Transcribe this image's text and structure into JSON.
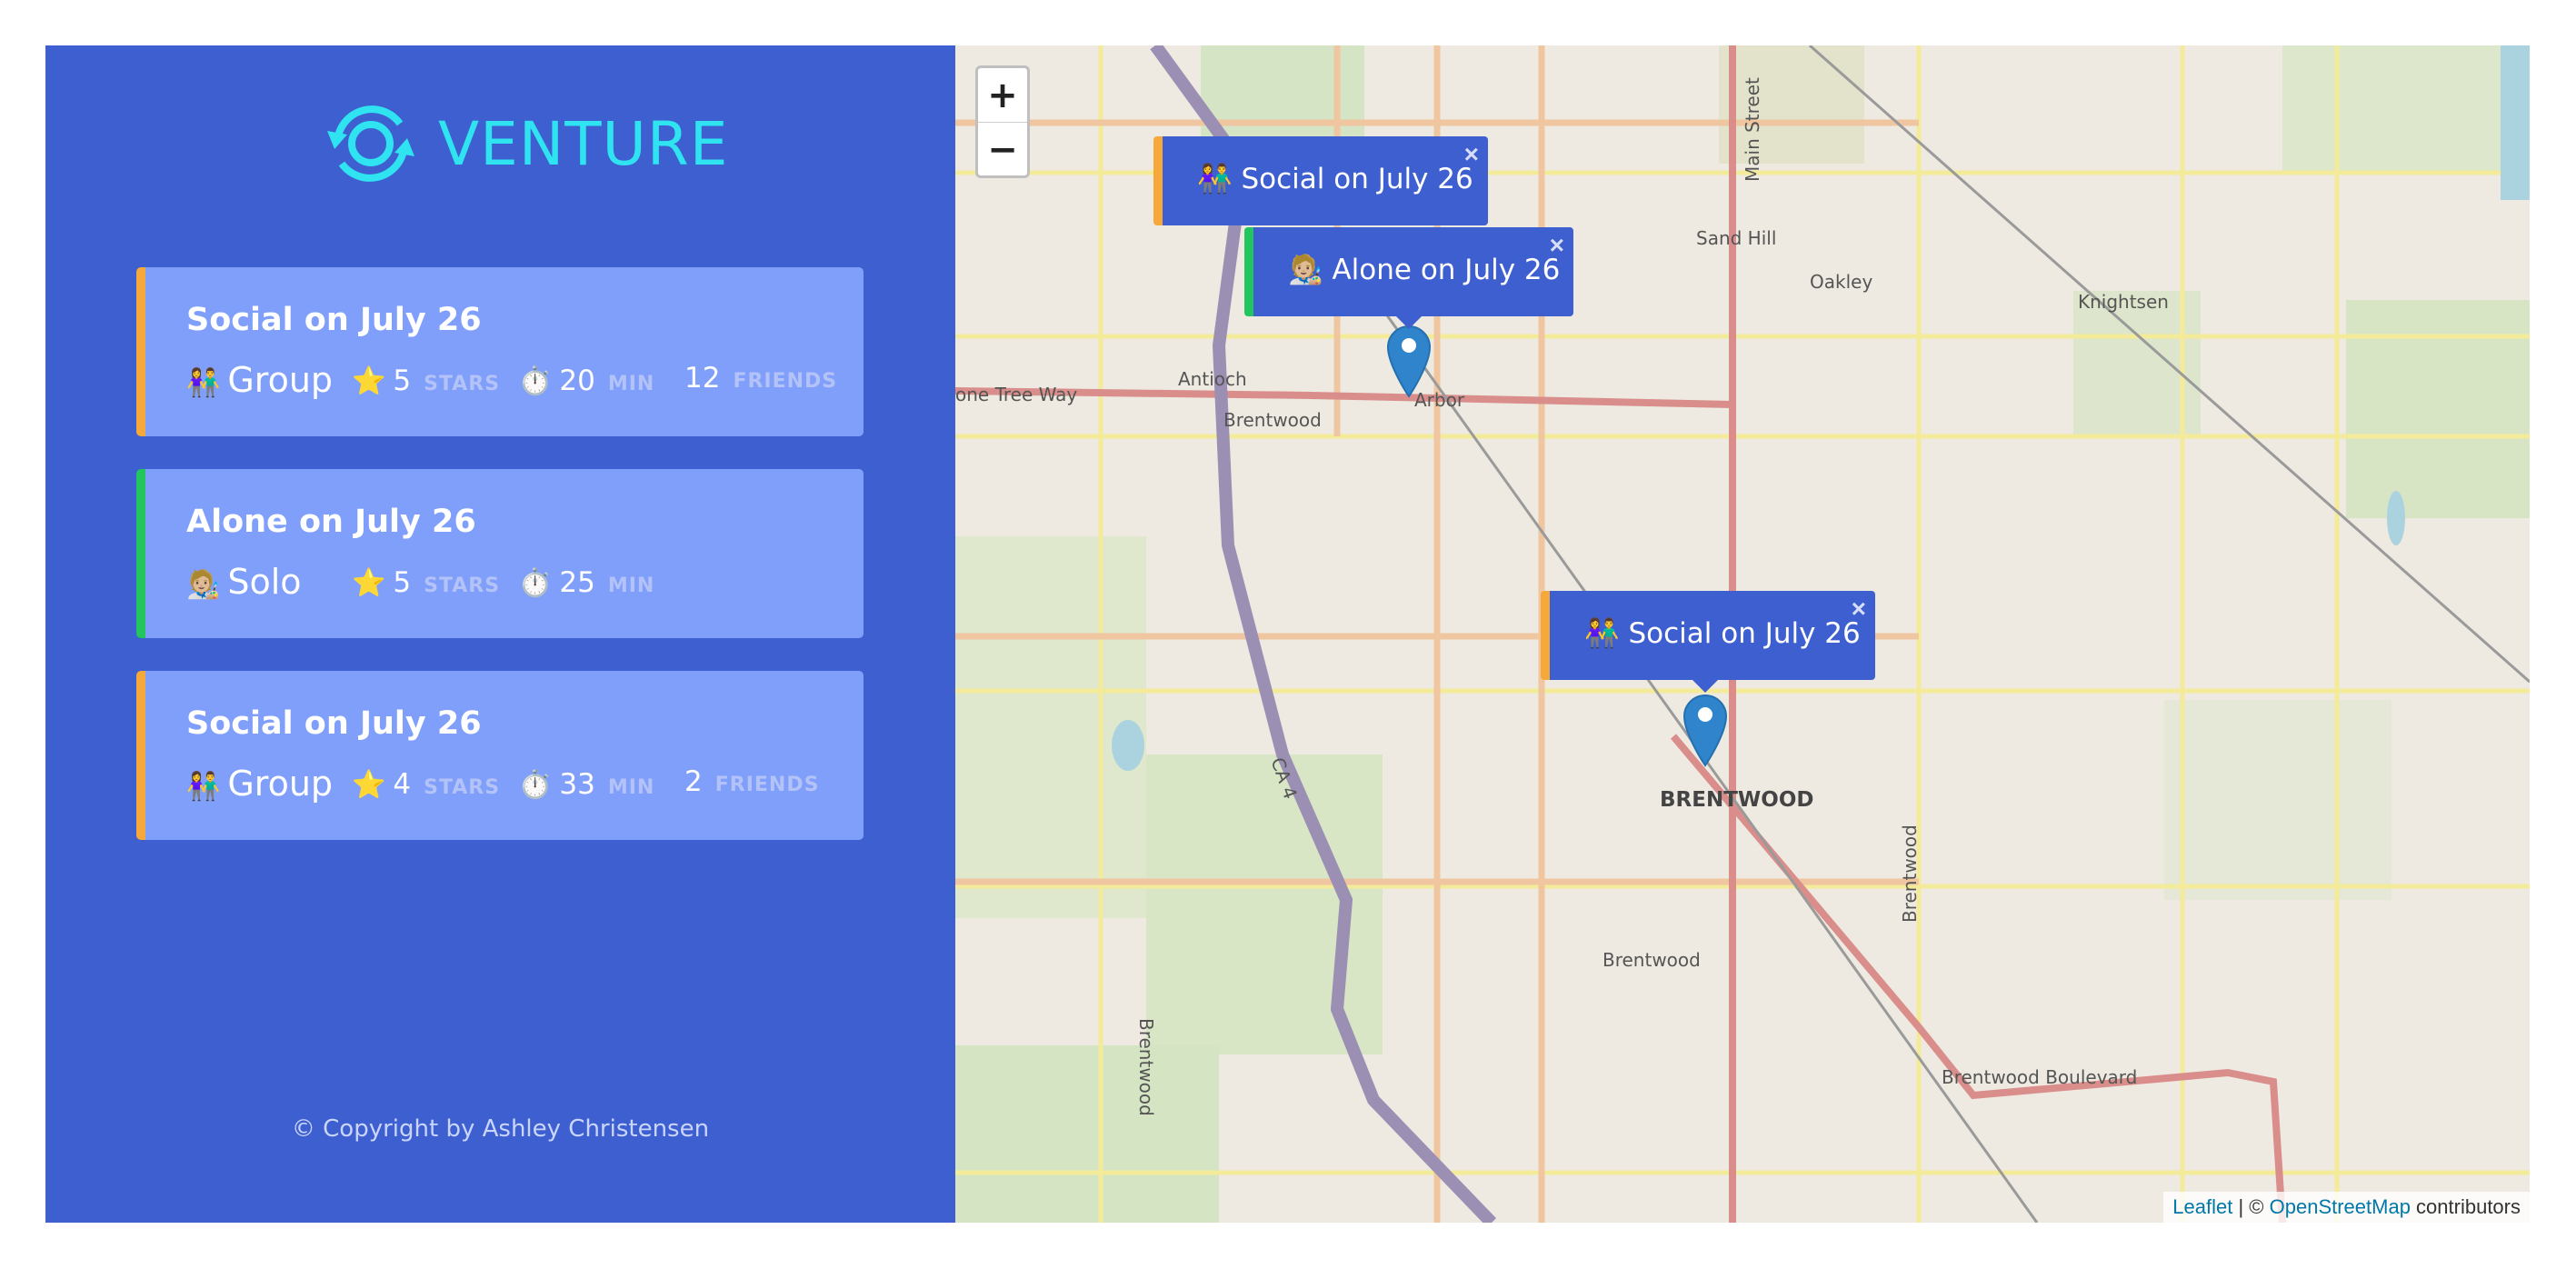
{
  "brand": {
    "name": "VENTURE",
    "logo_icon": "refresh-cycle-icon",
    "accent": "#2fe3f0"
  },
  "colors": {
    "sidebar": "#3e5fd0",
    "card": "#809ffb",
    "group_accent": "#f6a93b",
    "solo_accent": "#22c55e"
  },
  "ventures": [
    {
      "title": "Social on July 26",
      "type_emoji": "👫",
      "type_label": "Group",
      "star_emoji": "⭐",
      "stars": "5",
      "stars_unit": "STARS",
      "timer_emoji": "⏱️",
      "minutes": "20",
      "minutes_unit": "MIN",
      "friends": "12",
      "friends_unit": "FRIENDS"
    },
    {
      "title": "Alone on July 26",
      "type_emoji": "🧑🏼‍🎨",
      "type_label": "Solo",
      "star_emoji": "⭐",
      "stars": "5",
      "stars_unit": "STARS",
      "timer_emoji": "⏱️",
      "minutes": "25",
      "minutes_unit": "MIN"
    },
    {
      "title": "Social on July 26",
      "type_emoji": "👫",
      "type_label": "Group",
      "star_emoji": "⭐",
      "stars": "4",
      "stars_unit": "STARS",
      "timer_emoji": "⏱️",
      "minutes": "33",
      "minutes_unit": "MIN",
      "friends": "2",
      "friends_unit": "FRIENDS"
    }
  ],
  "footer": {
    "copyright": "© Copyright by Ashley Christensen"
  },
  "map": {
    "zoom_in": "+",
    "zoom_out": "−",
    "popups": [
      {
        "emoji": "👫",
        "text": "Social on July 26",
        "close": "×"
      },
      {
        "emoji": "🧑🏼‍🎨",
        "text": "Alone on July 26",
        "close": "×"
      },
      {
        "emoji": "👫",
        "text": "Social on July 26",
        "close": "×"
      }
    ],
    "labels": {
      "antioch": "Antioch",
      "brentwood_n": "Brentwood",
      "arbor": "Arbor",
      "lone_tree": "one Tree Way",
      "sand_hill": "Sand Hill",
      "oakley": "Oakley",
      "knightsen": "Knightsen",
      "main_street": "Main Street",
      "brentwood_city": "BRENTWOOD",
      "brentwood_s": "Brentwood",
      "brentwood_blvd": "Brentwood Boulevard",
      "ca4": "CA 4",
      "brentwood_v1": "Brentwood",
      "brentwood_v2": "Brentwood"
    },
    "attribution": {
      "leaflet": "Leaflet",
      "sep": " | © ",
      "osm": "OpenStreetMap",
      "suffix": " contributors"
    }
  }
}
